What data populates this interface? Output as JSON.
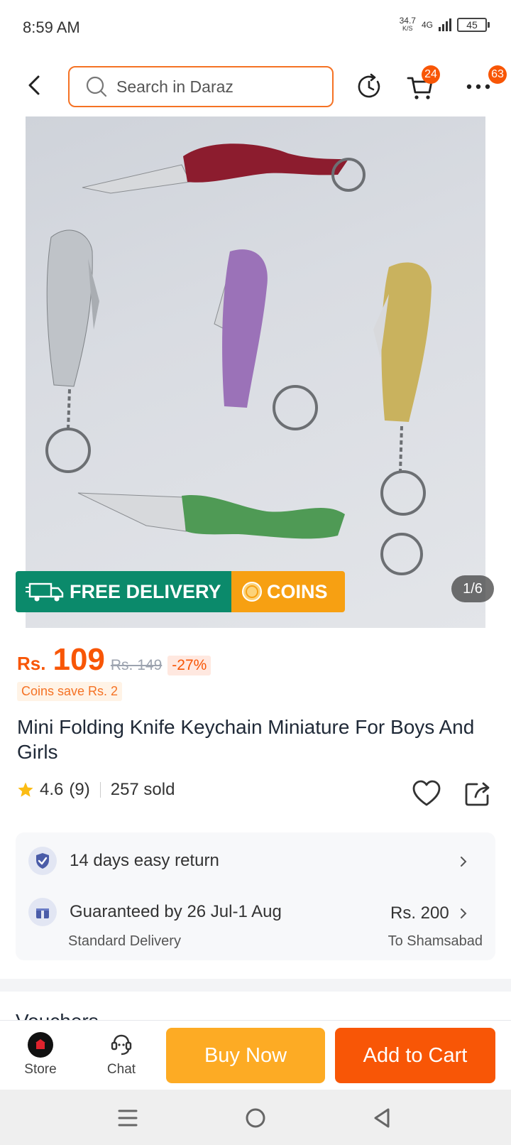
{
  "status_bar": {
    "time": "8:59 AM",
    "net_speed": "34.7",
    "net_unit": "K/S",
    "network": "4G",
    "battery": "45"
  },
  "header": {
    "search_placeholder": "Search in Daraz",
    "cart_badge": "24",
    "more_badge": "63"
  },
  "gallery": {
    "promo_free": "FREE DELIVERY",
    "promo_coins": "COINS",
    "page_indicator": "1/6"
  },
  "product": {
    "currency": "Rs.",
    "price": "109",
    "original_price": "Rs. 149",
    "discount": "-27%",
    "coins_save": "Coins save Rs. 2",
    "title": "Mini Folding Knife Keychain Miniature For Boys And Girls",
    "rating": "4.6",
    "rating_count": "(9)",
    "sold": "257 sold"
  },
  "service": {
    "return_text": "14 days easy return",
    "delivery_text": "Guaranteed by 26 Jul-1 Aug",
    "delivery_type": "Standard Delivery",
    "delivery_fee": "Rs. 200",
    "delivery_location": "To Shamsabad"
  },
  "vouchers_label": "Vouchers",
  "bottom_bar": {
    "store_label": "Store",
    "chat_label": "Chat",
    "buy_now": "Buy Now",
    "add_to_cart": "Add to Cart"
  },
  "colors": {
    "brand_orange": "#f85606",
    "buy_now_yellow": "#fdab24",
    "free_delivery_green": "#0b8a6b"
  }
}
